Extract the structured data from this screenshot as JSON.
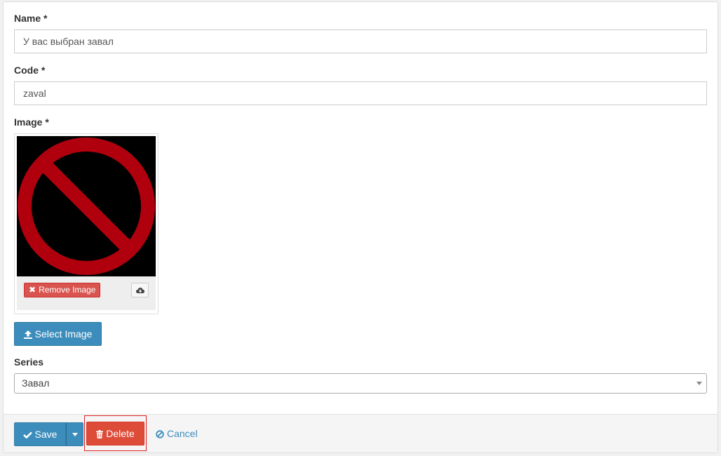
{
  "form": {
    "name_label": "Name *",
    "name_value": "У вас выбран завал",
    "code_label": "Code *",
    "code_value": "zaval",
    "image_label": "Image *",
    "remove_image_label": "Remove Image",
    "select_image_label": "Select Image",
    "series_label": "Series",
    "series_value": "Завал"
  },
  "actions": {
    "save_label": "Save",
    "delete_label": "Delete",
    "cancel_label": "Cancel"
  },
  "icons": {
    "check": "check-icon",
    "caret": "caret-down-icon",
    "trash": "trash-icon",
    "ban": "ban-icon",
    "upload": "upload-icon",
    "remove": "times-icon",
    "download": "cloud-download-icon"
  },
  "colors": {
    "primary": "#3c8dbc",
    "danger": "#dd4b39",
    "image_symbol": "#b0000e",
    "highlight": "#e02020"
  }
}
